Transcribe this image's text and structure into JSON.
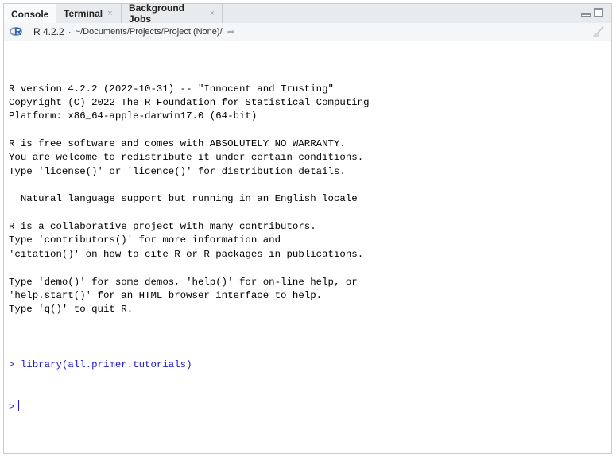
{
  "tabs": [
    {
      "label": "Console",
      "closable": false
    },
    {
      "label": "Terminal",
      "closable": true
    },
    {
      "label": "Background Jobs",
      "closable": true
    }
  ],
  "close_glyph": "×",
  "pathbar": {
    "r_version": "R 4.2.2",
    "separator": "·",
    "path": "~/Documents/Projects/Project (None)/",
    "goto_glyph": "➦"
  },
  "console": {
    "lines": [
      "R version 4.2.2 (2022-10-31) -- \"Innocent and Trusting\"",
      "Copyright (C) 2022 The R Foundation for Statistical Computing",
      "Platform: x86_64-apple-darwin17.0 (64-bit)",
      "",
      "R is free software and comes with ABSOLUTELY NO WARRANTY.",
      "You are welcome to redistribute it under certain conditions.",
      "Type 'license()' or 'licence()' for distribution details.",
      "",
      "  Natural language support but running in an English locale",
      "",
      "R is a collaborative project with many contributors.",
      "Type 'contributors()' for more information and",
      "'citation()' on how to cite R or R packages in publications.",
      "",
      "Type 'demo()' for some demos, 'help()' for on-line help, or",
      "'help.start()' for an HTML browser interface to help.",
      "Type 'q()' to quit R.",
      ""
    ],
    "command": "> library(all.primer.tutorials)",
    "prompt": ">"
  },
  "colors": {
    "command": "#1b19c9",
    "r_logo_letter": "#2165b6",
    "tabbar_bg": "#e8ebee"
  },
  "icons": [
    "r-logo-icon",
    "close-icon",
    "minimize-icon",
    "maximize-icon",
    "go-to-directory-icon",
    "clear-console-broom-icon"
  ]
}
